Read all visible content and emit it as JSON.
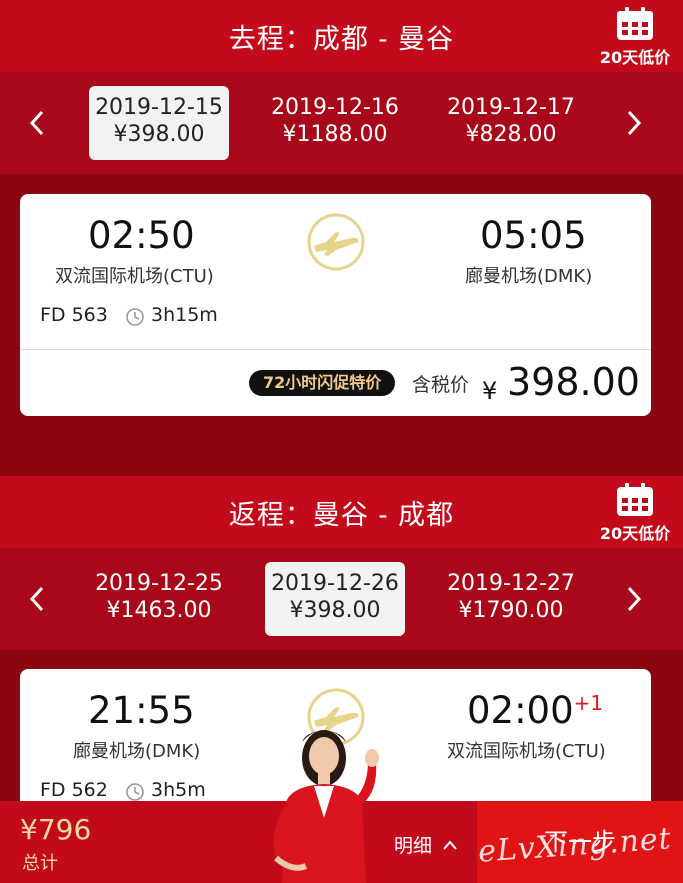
{
  "outbound": {
    "title": "去程：成都 - 曼谷",
    "calendar_label": "20天低价",
    "dates": [
      {
        "date": "2019-12-15",
        "price": "¥398.00",
        "active": true
      },
      {
        "date": "2019-12-16",
        "price": "¥1188.00",
        "active": false
      },
      {
        "date": "2019-12-17",
        "price": "¥828.00",
        "active": false
      }
    ],
    "flight": {
      "dep_time": "02:50",
      "dep_airport": "双流国际机场(CTU)",
      "arr_time": "05:05",
      "arr_airport": "廊曼机场(DMK)",
      "flight_no": "FD 563",
      "duration": "3h15m",
      "promo": "72小时闪促特价",
      "tax_label": "含税价",
      "currency": "¥",
      "price": "398.00"
    }
  },
  "return": {
    "title": "返程：曼谷 - 成都",
    "calendar_label": "20天低价",
    "dates": [
      {
        "date": "2019-12-25",
        "price": "¥1463.00",
        "active": false
      },
      {
        "date": "2019-12-26",
        "price": "¥398.00",
        "active": true
      },
      {
        "date": "2019-12-27",
        "price": "¥1790.00",
        "active": false
      }
    ],
    "flight": {
      "dep_time": "21:55",
      "dep_airport": "廊曼机场(DMK)",
      "arr_time": "02:00",
      "arr_day_offset": "+1",
      "arr_airport": "双流国际机场(CTU)",
      "flight_no": "FD 562",
      "duration": "3h5m"
    }
  },
  "bottom": {
    "total_price": "¥796",
    "total_label": "总计",
    "detail_label": "明细",
    "next_label": "下一步",
    "watermark": "eLvXing.net"
  },
  "icons": {
    "calendar": "calendar-icon",
    "prev": "chevron-left-icon",
    "next": "chevron-right-icon",
    "airline": "airline-logo-icon",
    "clock": "clock-icon",
    "expand": "chevron-up-icon"
  },
  "colors": {
    "header_red": "#c20a1b",
    "strip_red": "#a8081a",
    "bg_red": "#8c0612",
    "gold": "#e8d38a",
    "price_gold": "#f4d9a4",
    "next_red": "#e01414"
  }
}
